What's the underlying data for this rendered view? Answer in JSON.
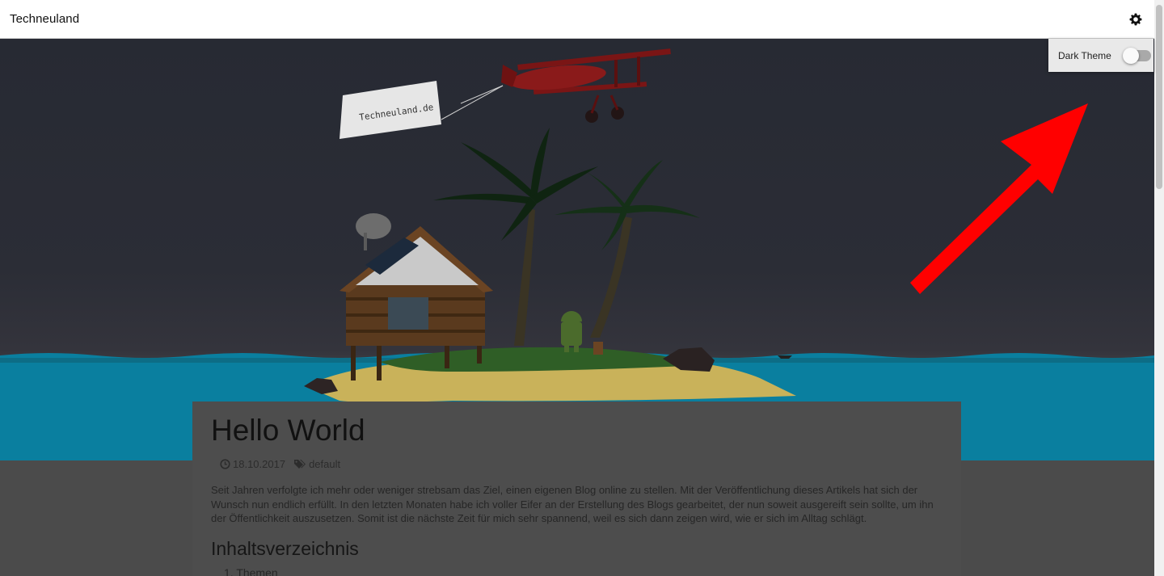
{
  "header": {
    "brand": "Techneuland",
    "settings_icon": "gear-icon"
  },
  "settings_menu": {
    "dark_theme_label": "Dark Theme",
    "dark_theme_enabled": false
  },
  "hero": {
    "banner_text": "Techneuland.de"
  },
  "post": {
    "title": "Hello World",
    "date": "18.10.2017",
    "date_icon": "clock-icon",
    "tag": "default",
    "tag_icon": "tags-icon",
    "intro": "Seit Jahren verfolgte ich mehr oder weniger strebsam das Ziel, einen eigenen Blog online zu stellen. Mit der Veröffentlichung dieses Artikels hat sich der Wunsch nun endlich erfüllt. In den letzten Monaten habe ich voller Eifer an der Erstellung des Blogs gearbeitet, der nun soweit ausgereift sein sollte, um ihn der Öffentlichkeit auszusetzen. Somit ist die nächste Zeit für mich sehr spannend, weil es sich dann zeigen wird, wie er sich im Alltag schlägt.",
    "toc_title": "Inhaltsverzeichnis",
    "toc_items": [
      "1. Themen"
    ]
  },
  "colors": {
    "annotation_arrow": "#ff0000",
    "water": "#0a7f9f",
    "sand": "#c9b25a"
  }
}
